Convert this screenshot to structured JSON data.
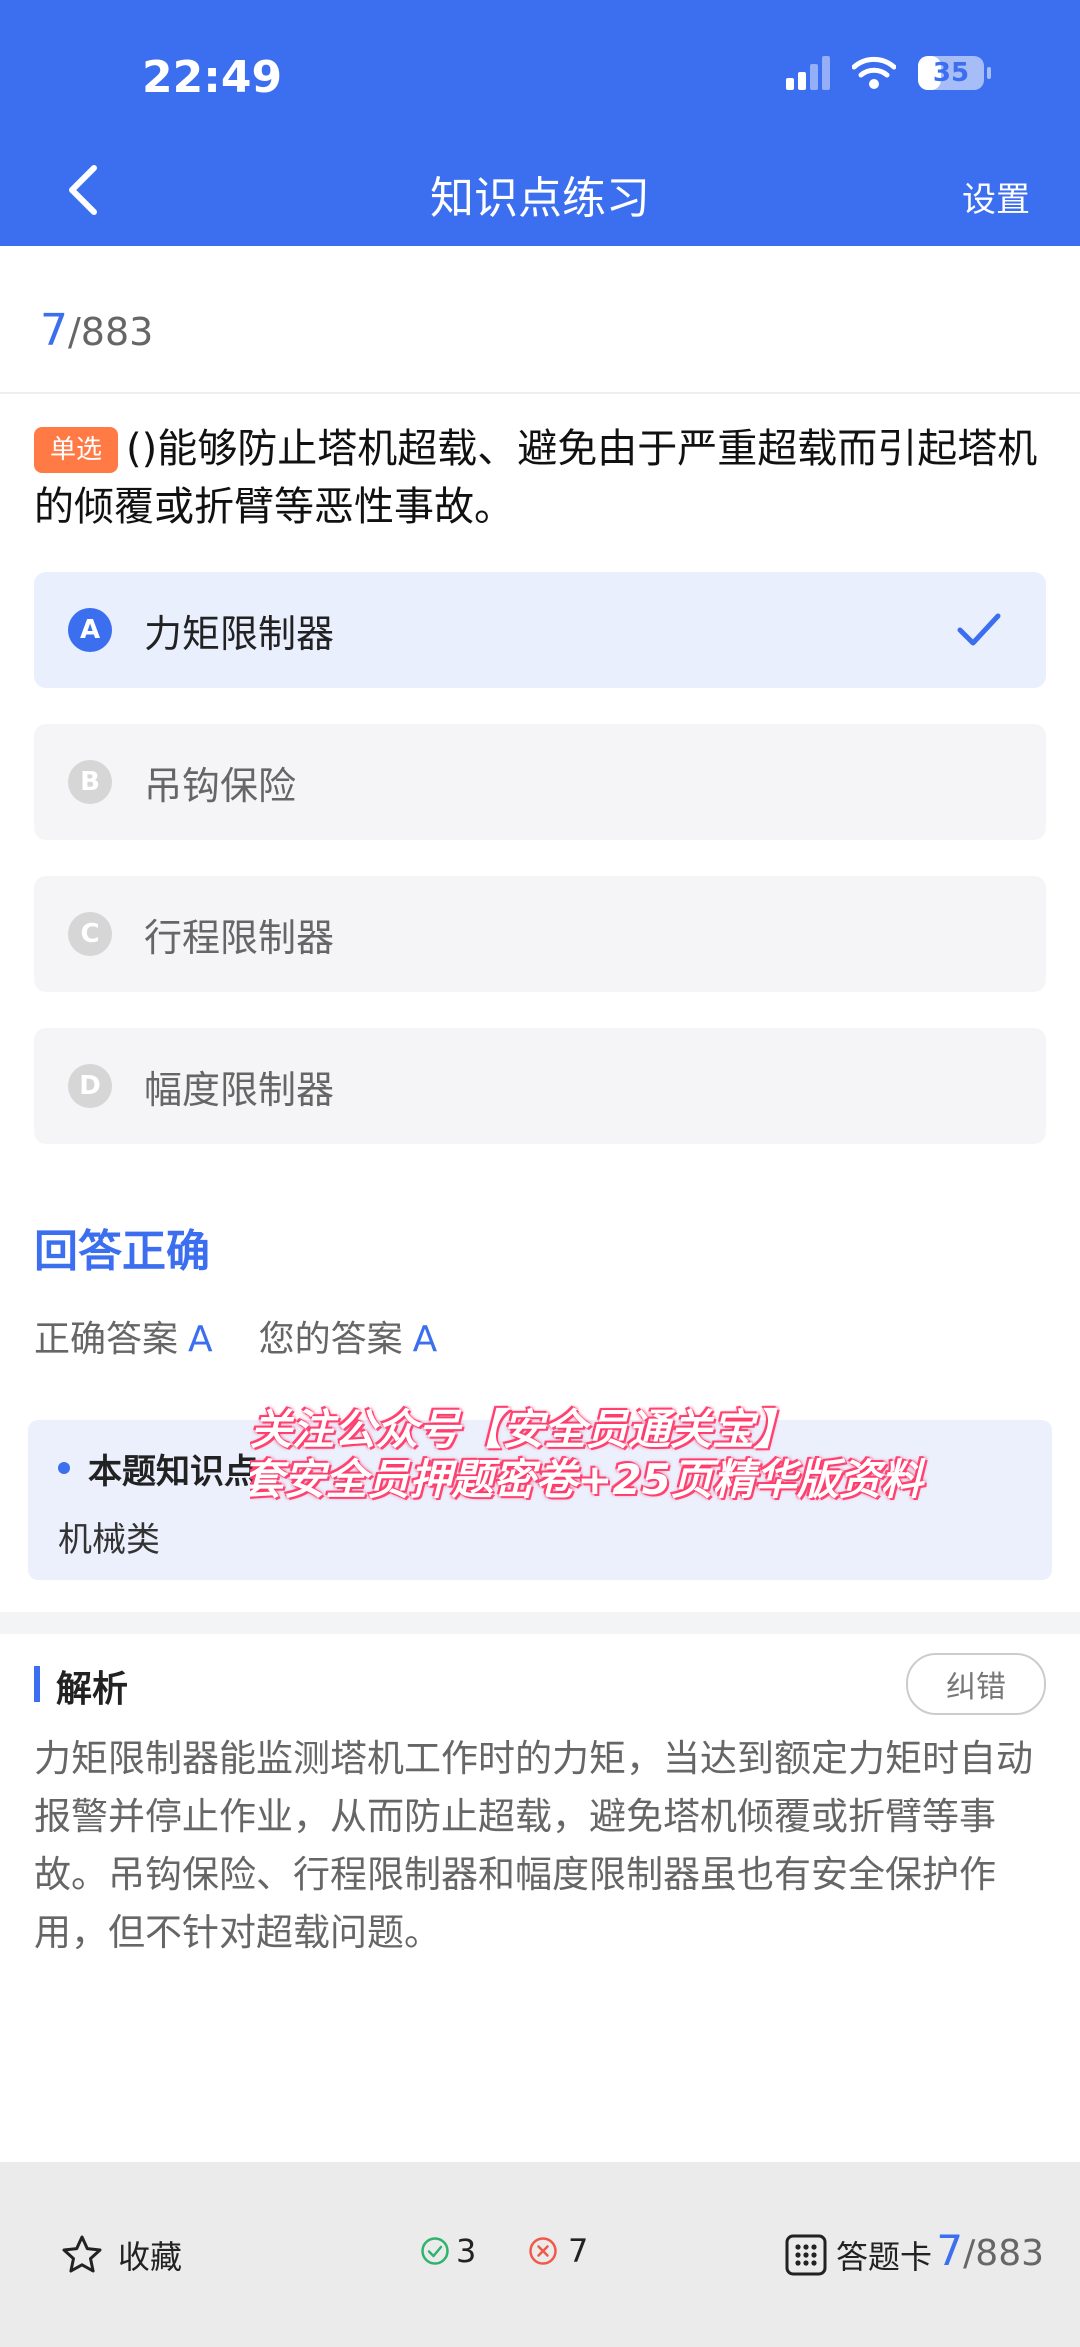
{
  "status_bar": {
    "time": "22:49",
    "battery": "35",
    "battery_level": 0.35
  },
  "nav": {
    "title": "知识点练习",
    "settings": "设置"
  },
  "progress": {
    "current": "7",
    "total": "/883"
  },
  "question": {
    "type_badge": "单选",
    "text": "()能够防止塔机超载、避免由于严重超载而引起塔机的倾覆或折臂等恶性事故。",
    "options": [
      {
        "letter": "A",
        "text": "力矩限制器",
        "selected": true
      },
      {
        "letter": "B",
        "text": "吊钩保险",
        "selected": false
      },
      {
        "letter": "C",
        "text": "行程限制器",
        "selected": false
      },
      {
        "letter": "D",
        "text": "幅度限制器",
        "selected": false
      }
    ]
  },
  "result": {
    "title": "回答正确",
    "correct_label": "正确答案",
    "correct_value": "A",
    "yours_label": "您的答案",
    "yours_value": "A"
  },
  "knowledge_point": {
    "label": "本题知识点",
    "value": "机械类"
  },
  "watermark": {
    "line1": "关注公众号【安全员通关宝】",
    "line2": "领5套安全员押题密卷+25页精华版资料"
  },
  "analysis": {
    "title": "解析",
    "report_button": "纠错",
    "text": "力矩限制器能监测塔机工作时的力矩，当达到额定力矩时自动报警并停止作业，从而防止超载，避免塔机倾覆或折臂等事故。吊钩保险、行程限制器和幅度限制器虽也有安全保护作用，但不针对超载问题。"
  },
  "bottom_bar": {
    "favorite": "收藏",
    "correct_count": "3",
    "wrong_count": "7",
    "answer_card": "答题卡",
    "current": "7",
    "total": "/883"
  },
  "colors": {
    "primary": "#3c6ef0",
    "badge": "#ff7a45",
    "correct": "#2fb36d",
    "wrong": "#f05a4a"
  }
}
